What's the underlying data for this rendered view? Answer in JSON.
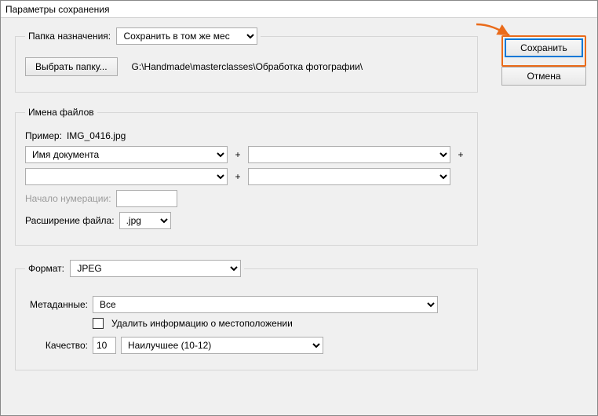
{
  "window": {
    "title": "Параметры сохранения"
  },
  "dest": {
    "legend": "Папка назначения:",
    "mode": "Сохранить в том же месте",
    "choose_btn": "Выбрать папку...",
    "path": "G:\\Handmade\\masterclasses\\Обработка фотографии\\"
  },
  "names": {
    "legend": "Имена файлов",
    "example_label": "Пример:",
    "example_value": "IMG_0416.jpg",
    "field1": "Имя документа",
    "field2": "",
    "field3": "",
    "field4": "",
    "plus": "+",
    "start_num_label": "Начало нумерации:",
    "start_num_value": "",
    "ext_label": "Расширение файла:",
    "ext_value": ".jpg"
  },
  "format": {
    "legend": "Формат:",
    "value": "JPEG",
    "meta_label": "Метаданные:",
    "meta_value": "Все",
    "remove_loc_label": "Удалить информацию о местоположении",
    "quality_label": "Качество:",
    "quality_num": "10",
    "quality_preset": "Наилучшее  (10-12)"
  },
  "buttons": {
    "save": "Сохранить",
    "cancel": "Отмена"
  }
}
